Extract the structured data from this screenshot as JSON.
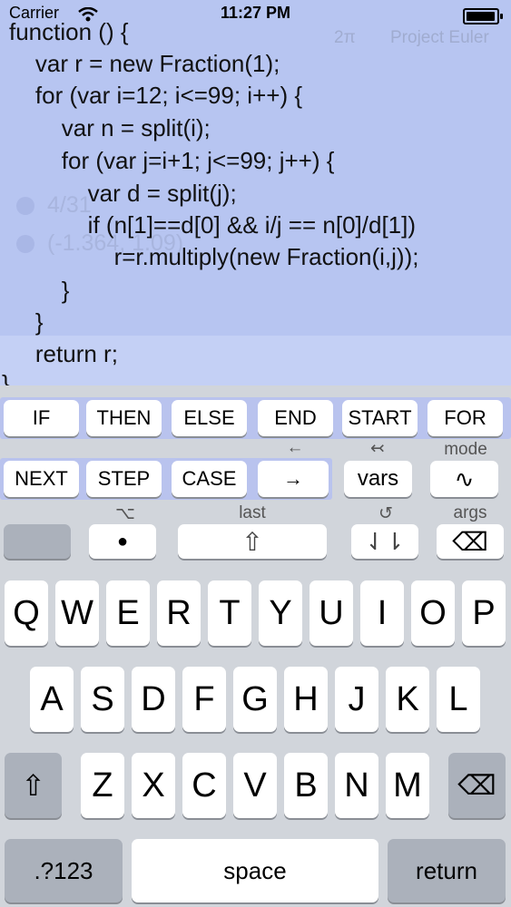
{
  "status_bar": {
    "carrier": "Carrier",
    "time": "11:27 PM"
  },
  "header": {
    "two_pi": "2π",
    "title": "Project Euler"
  },
  "history": [
    {
      "text": "4/31"
    },
    {
      "text": "(-1.364, 1.09)"
    }
  ],
  "code": [
    "function () {",
    "    var r = new Fraction(1);",
    "    for (var i=12; i<=99; i++) {",
    "        var n = split(i);",
    "        for (var j=i+1; j<=99; j++) {",
    "            var d = split(j);",
    "            if (n[1]==d[0] && i/j == n[0]/d[1])",
    "                r=r.multiply(new Fraction(i,j));",
    "        }",
    "    }",
    "    return r;",
    "}"
  ],
  "keyword_row1": [
    "IF",
    "THEN",
    "ELSE",
    "END",
    "START",
    "FOR"
  ],
  "keyword_row2": [
    "NEXT",
    "STEP",
    "CASE"
  ],
  "special": {
    "arrow_right": "→",
    "arrow_left_hint": "←",
    "vars": "vars",
    "vars_hint": "↢",
    "mode_hint": "mode",
    "wave": "∿",
    "dot": "●",
    "option_hint": "⌥",
    "last_hint": "last",
    "shift_up": "⇧",
    "undo_hint": "↺",
    "down_arrows": "⇃⇂",
    "args_hint": "args",
    "backspace": "⌫"
  },
  "letters_row1": [
    "Q",
    "W",
    "E",
    "R",
    "T",
    "Y",
    "U",
    "I",
    "O",
    "P"
  ],
  "letters_row2": [
    "A",
    "S",
    "D",
    "F",
    "G",
    "H",
    "J",
    "K",
    "L"
  ],
  "letters_row3": [
    "Z",
    "X",
    "C",
    "V",
    "B",
    "N",
    "M"
  ],
  "bottom": {
    "numbers": ".?123",
    "space": "space",
    "return": "return"
  },
  "icons": {
    "shift": "⇧",
    "delete": "⌫"
  }
}
